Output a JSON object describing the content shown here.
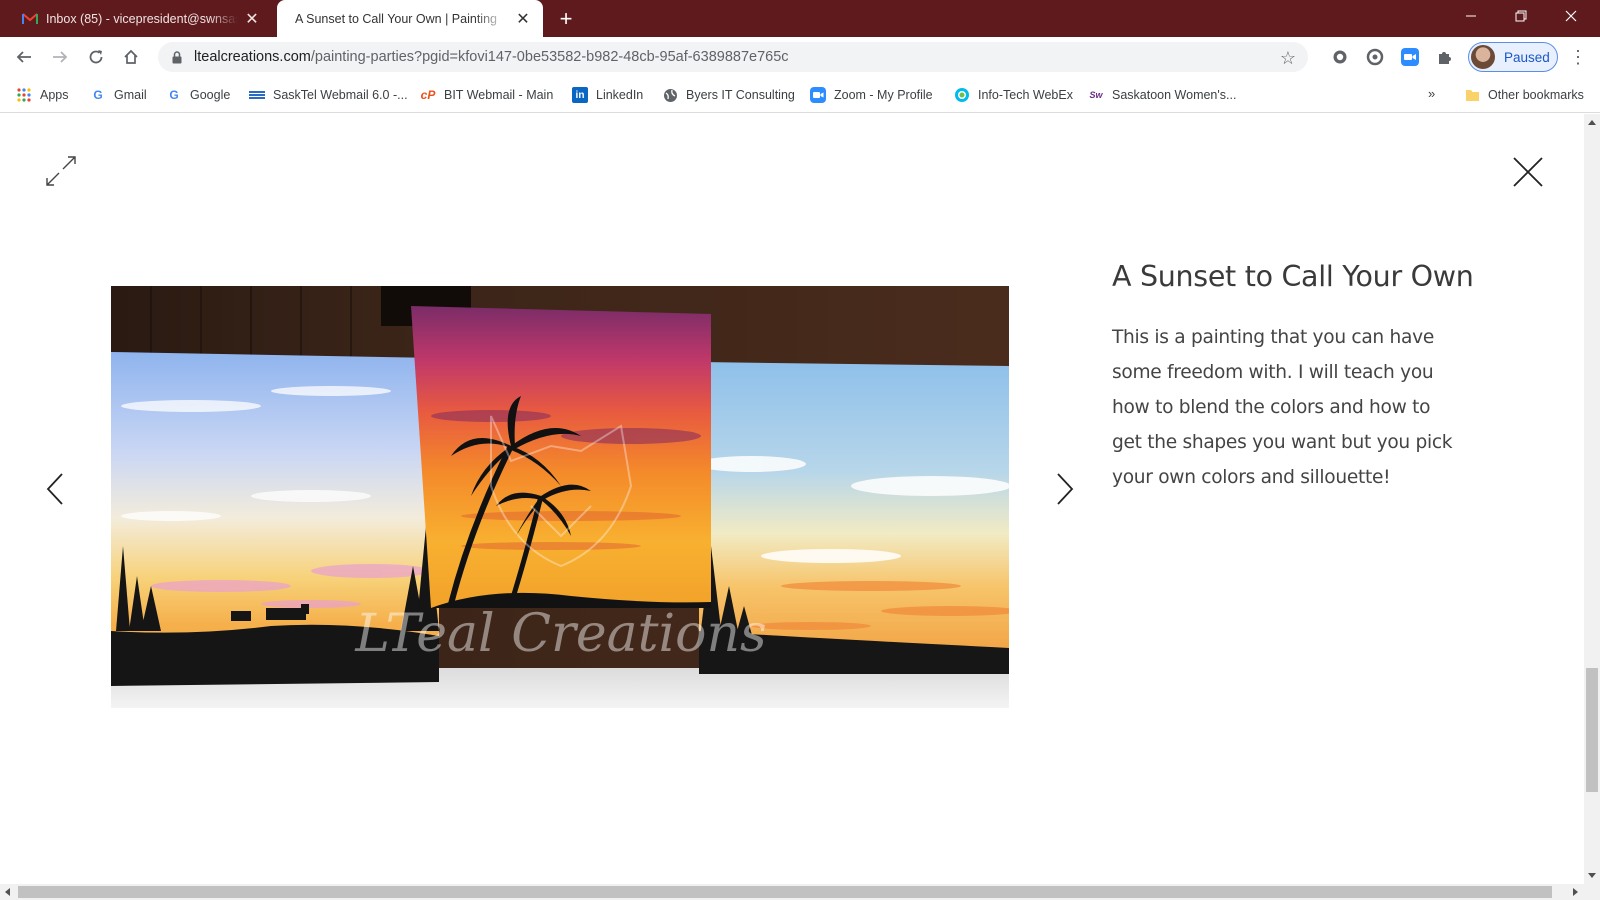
{
  "browser": {
    "tabs": [
      {
        "title": "Inbox (85) - vicepresident@swnsask",
        "favicon": "gmail-icon",
        "active": false
      },
      {
        "title": "A Sunset to Call Your Own | Painting",
        "favicon": "page-icon",
        "active": true
      }
    ],
    "url": {
      "host": "ltealcreations.com",
      "path": "/painting-parties?pgid=kfovi147-0be53582-b982-48cb-95af-6389887e765c"
    },
    "profile_label": "Paused",
    "bookmarks": [
      {
        "label": "Apps",
        "icon": "apps-grid-icon"
      },
      {
        "label": "Gmail",
        "icon": "google-icon"
      },
      {
        "label": "Google",
        "icon": "google-icon"
      },
      {
        "label": "SaskTel Webmail 6.0 -...",
        "icon": "sasktel-icon"
      },
      {
        "label": "BIT Webmail - Main",
        "icon": "bit-icon"
      },
      {
        "label": "LinkedIn",
        "icon": "linkedin-icon"
      },
      {
        "label": "Byers IT Consulting",
        "icon": "globe-icon"
      },
      {
        "label": "Zoom - My Profile",
        "icon": "zoom-icon"
      },
      {
        "label": "Info-Tech WebEx",
        "icon": "webex-icon"
      },
      {
        "label": "Saskatoon Women's...",
        "icon": "swn-icon"
      }
    ],
    "bookmarks_overflow": "»",
    "other_bookmarks": "Other bookmarks"
  },
  "lightbox": {
    "title": "A Sunset to Call Your Own",
    "description": "This is a painting that you can have some freedom with. I will teach you how to blend the colors and how to get the shapes you want but you pick your own colors and sillouette!",
    "watermark": "LTeal Creations"
  },
  "colors": {
    "tabstrip": "#5e1a1d",
    "accent_blue": "#1a73e8"
  }
}
